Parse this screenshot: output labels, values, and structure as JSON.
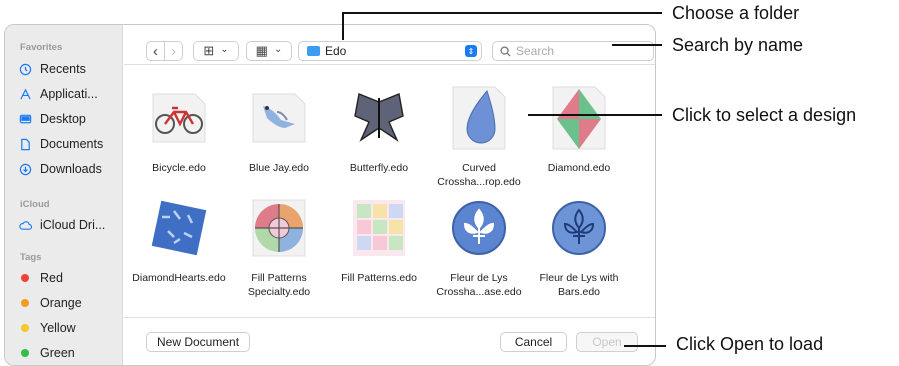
{
  "sidebar": {
    "favorites_heading": "Favorites",
    "favorites": [
      {
        "icon": "clock-icon",
        "label": "Recents"
      },
      {
        "icon": "applications-icon",
        "label": "Applicati..."
      },
      {
        "icon": "desktop-icon",
        "label": "Desktop"
      },
      {
        "icon": "document-icon",
        "label": "Documents"
      },
      {
        "icon": "download-icon",
        "label": "Downloads"
      }
    ],
    "icloud_heading": "iCloud",
    "icloud": [
      {
        "icon": "cloud-icon",
        "label": "iCloud Dri..."
      }
    ],
    "tags_heading": "Tags",
    "tags": [
      {
        "label": "Red",
        "color": "#f0443b"
      },
      {
        "label": "Orange",
        "color": "#f49a1e"
      },
      {
        "label": "Yellow",
        "color": "#f5c72b"
      },
      {
        "label": "Green",
        "color": "#2fbf4a"
      }
    ]
  },
  "toolbar": {
    "back_glyph": "‹",
    "forward_glyph": "›",
    "icon_view_glyph": "⊞",
    "group_glyph": "▦",
    "chevron": "⌄",
    "folder_name": "Edo",
    "search_placeholder": "Search"
  },
  "files": [
    {
      "name": "Bicycle.edo",
      "thumb": "bicycle"
    },
    {
      "name": "Blue Jay.edo",
      "thumb": "bluejay"
    },
    {
      "name": "Butterfly.edo",
      "thumb": "butterfly"
    },
    {
      "name": "Curved Crossha...rop.edo",
      "thumb": "drop"
    },
    {
      "name": "Diamond.edo",
      "thumb": "diamond"
    },
    {
      "name": "DiamondHearts.edo",
      "thumb": "hearts"
    },
    {
      "name": "Fill Patterns Specialty.edo",
      "thumb": "specialty"
    },
    {
      "name": "Fill Patterns.edo",
      "thumb": "hex"
    },
    {
      "name": "Fleur de Lys Crossha...ase.edo",
      "thumb": "fleur"
    },
    {
      "name": "Fleur de Lys with Bars.edo",
      "thumb": "fleur-bars"
    }
  ],
  "footer": {
    "new_document": "New Document",
    "cancel": "Cancel",
    "open": "Open"
  },
  "callouts": {
    "choose_folder": "Choose a folder",
    "search_by_name": "Search by name",
    "select_design": "Click to select a design",
    "open_to_load": "Click Open to load"
  },
  "colors": {
    "accent": "#1a7cf5",
    "folder": "#3b9cf0",
    "design_blue": "#3f6fc4"
  }
}
